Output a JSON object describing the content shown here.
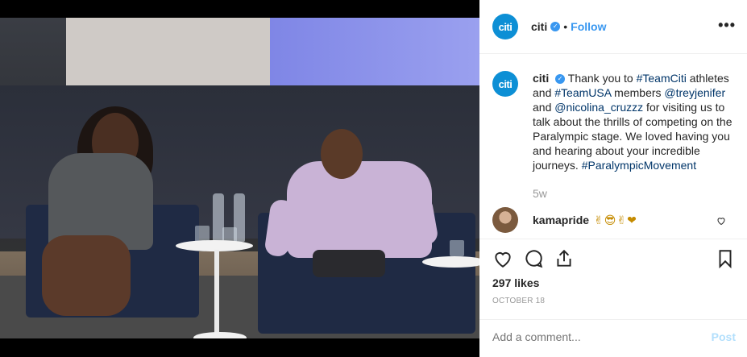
{
  "header": {
    "avatar_text": "citi",
    "username": "citi",
    "separator": "•",
    "follow_label": "Follow",
    "more_label": "•••"
  },
  "caption": {
    "avatar_text": "citi",
    "username": "citi",
    "text_1": "Thank you to ",
    "tag_1": "#TeamCiti",
    "text_2": " athletes and ",
    "tag_2": "#TeamUSA",
    "text_3": " members ",
    "mention_1": "@treyjenifer",
    "text_4": " and ",
    "mention_2": "@nicolina_cruzzz",
    "text_5": " for visiting us to talk about the thrills of competing on the Paralympic stage. We loved having you and hearing about your incredible journeys. ",
    "tag_3": "#ParalympicMovement",
    "age": "5w"
  },
  "comment": {
    "username": "kamapride",
    "text": "✌😎✌❤"
  },
  "stats": {
    "likes": "297 likes",
    "date": "OCTOBER 18"
  },
  "add_comment": {
    "placeholder": "Add a comment...",
    "post_label": "Post"
  },
  "colors": {
    "accent": "#3897f0",
    "brand": "#0d8fd5",
    "link": "#003569"
  },
  "icons": [
    "heart-icon",
    "comment-icon",
    "share-icon",
    "bookmark-icon",
    "small-heart-icon",
    "verified-icon"
  ]
}
